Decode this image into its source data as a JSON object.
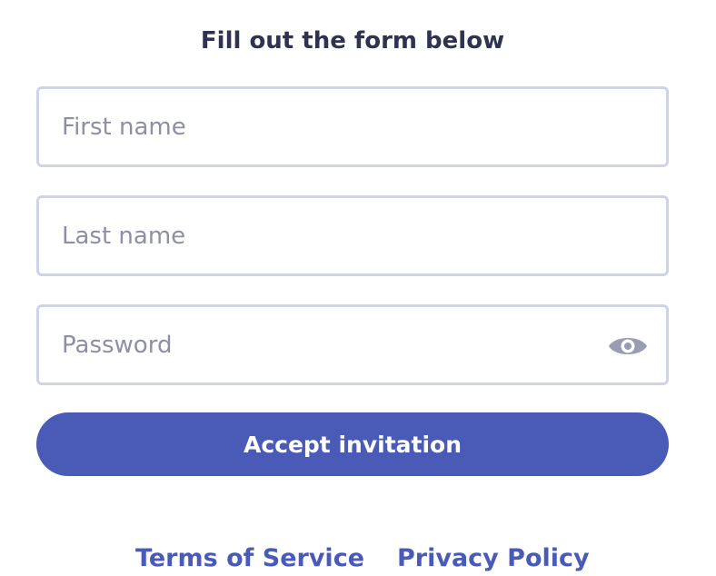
{
  "form": {
    "title": "Fill out the form below",
    "first_name": {
      "value": "",
      "placeholder": "First name"
    },
    "last_name": {
      "value": "",
      "placeholder": "Last name"
    },
    "password": {
      "value": "",
      "placeholder": "Password",
      "toggle_icon": "eye-icon"
    },
    "submit_label": "Accept invitation"
  },
  "footer": {
    "terms_label": "Terms of Service",
    "privacy_label": "Privacy Policy"
  },
  "colors": {
    "accent": "#4a5bb7",
    "border": "#cfd3ea",
    "title_text": "#2f3350",
    "placeholder_text": "#8e8fa6",
    "eye_icon": "#9a9cb2"
  }
}
